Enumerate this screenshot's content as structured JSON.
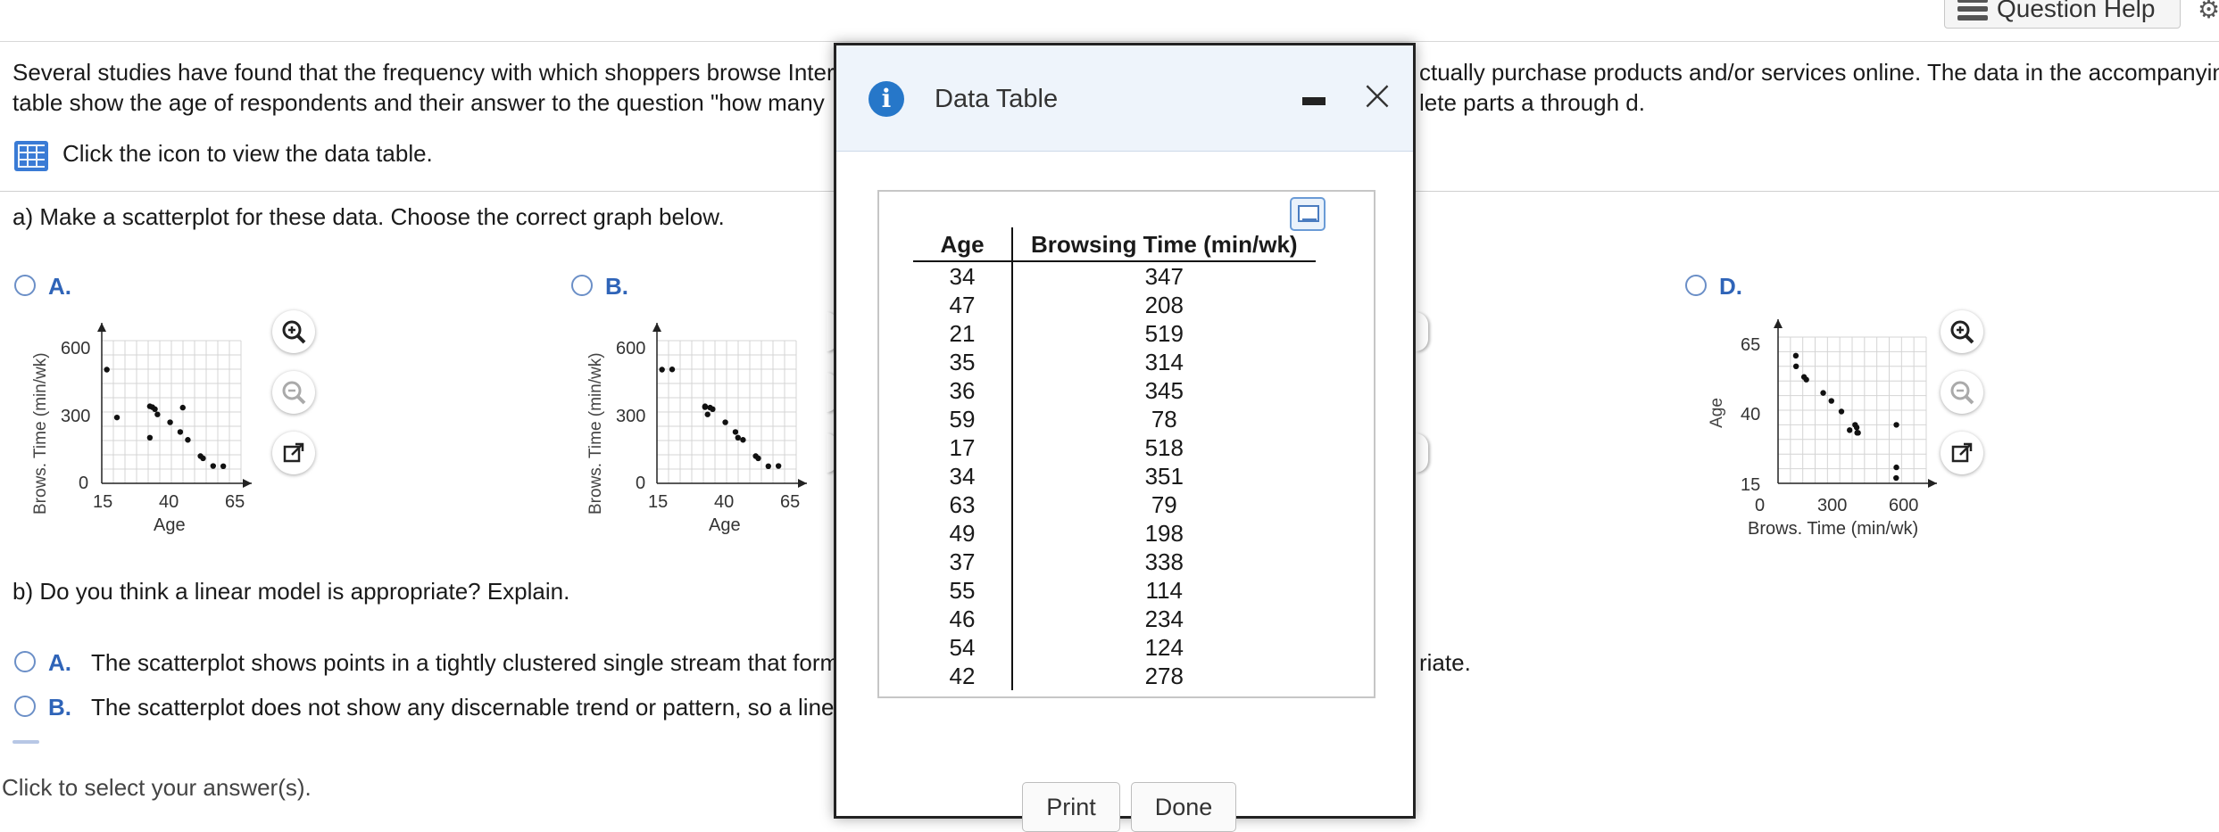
{
  "header": {
    "question_help_label": "Question Help"
  },
  "question": {
    "intro_line1_left": "Several studies have found that the frequency with which shoppers browse Inter",
    "intro_line1_right": "ctually purchase products and/or services online. The data in the accompanyin",
    "intro_line2_left": "table show the age of respondents and their answer to the question \"how many",
    "intro_line2_right": "lete parts a through d.",
    "click_icon_text": "Click the icon to view the data table.",
    "part_a": "a) Make a scatterplot for these data. Choose the correct graph below.",
    "part_b": "b) Do you think a linear model is appropriate? Explain.",
    "footer": "Click to select your answer(s).",
    "accent_color": "#2f64b8"
  },
  "graph_options": [
    {
      "label": "A.",
      "chart_data": {
        "type": "scatter",
        "xlabel": "Age",
        "ylabel": "Brows. Time (min/wk)",
        "xticks": [
          "15",
          "40",
          "65"
        ],
        "yticks": [
          "0",
          "300",
          "600"
        ],
        "xlim": [
          15,
          70
        ],
        "ylim": [
          0,
          650
        ],
        "points": [
          [
            17,
            518
          ],
          [
            21,
            300
          ],
          [
            34,
            351
          ],
          [
            34,
            208
          ],
          [
            35,
            347
          ],
          [
            36,
            338
          ],
          [
            37,
            314
          ],
          [
            42,
            278
          ],
          [
            46,
            234
          ],
          [
            47,
            345
          ],
          [
            49,
            198
          ],
          [
            54,
            124
          ],
          [
            55,
            114
          ],
          [
            59,
            79
          ],
          [
            63,
            78
          ]
        ]
      }
    },
    {
      "label": "B.",
      "chart_data": {
        "type": "scatter",
        "xlabel": "Age",
        "ylabel": "Brows. Time (min/wk)",
        "xticks": [
          "15",
          "40",
          "65"
        ],
        "yticks": [
          "0",
          "300",
          "600"
        ],
        "xlim": [
          15,
          70
        ],
        "ylim": [
          0,
          650
        ],
        "points": [
          [
            17,
            518
          ],
          [
            21,
            519
          ],
          [
            34,
            347
          ],
          [
            34,
            351
          ],
          [
            35,
            314
          ],
          [
            36,
            345
          ],
          [
            37,
            338
          ],
          [
            42,
            278
          ],
          [
            46,
            234
          ],
          [
            47,
            208
          ],
          [
            49,
            198
          ],
          [
            54,
            124
          ],
          [
            55,
            114
          ],
          [
            59,
            78
          ],
          [
            63,
            79
          ]
        ]
      }
    },
    {
      "label": "D.",
      "chart_data": {
        "type": "scatter",
        "xlabel": "Brows. Time (min/wk)",
        "ylabel": "Age",
        "xticks": [
          "0",
          "300",
          "600"
        ],
        "yticks": [
          "15",
          "40",
          "65"
        ],
        "xlim": [
          0,
          650
        ],
        "ylim": [
          15,
          70
        ],
        "points": [
          [
            78,
            63
          ],
          [
            79,
            59
          ],
          [
            114,
            55
          ],
          [
            124,
            54
          ],
          [
            198,
            49
          ],
          [
            234,
            46
          ],
          [
            278,
            42
          ],
          [
            314,
            35
          ],
          [
            338,
            37
          ],
          [
            345,
            36
          ],
          [
            347,
            34
          ],
          [
            351,
            34
          ],
          [
            519,
            21
          ],
          [
            518,
            17
          ],
          [
            519,
            37
          ]
        ]
      }
    }
  ],
  "answers_b": [
    {
      "label": "A.",
      "text_left": "The scatterplot shows points in a tightly clustered single stream that form",
      "text_right": "riate."
    },
    {
      "label": "B.",
      "text_left": "The scatterplot does not show any discernable trend or pattern, so a line"
    }
  ],
  "modal": {
    "title": "Data Table",
    "columns": [
      "Age",
      "Browsing Time (min/wk)"
    ],
    "rows": [
      [
        "34",
        "347"
      ],
      [
        "47",
        "208"
      ],
      [
        "21",
        "519"
      ],
      [
        "35",
        "314"
      ],
      [
        "36",
        "345"
      ],
      [
        "59",
        "78"
      ],
      [
        "17",
        "518"
      ],
      [
        "34",
        "351"
      ],
      [
        "63",
        "79"
      ],
      [
        "49",
        "198"
      ],
      [
        "37",
        "338"
      ],
      [
        "55",
        "114"
      ],
      [
        "46",
        "234"
      ],
      [
        "54",
        "124"
      ],
      [
        "42",
        "278"
      ]
    ],
    "print_label": "Print",
    "done_label": "Done"
  }
}
